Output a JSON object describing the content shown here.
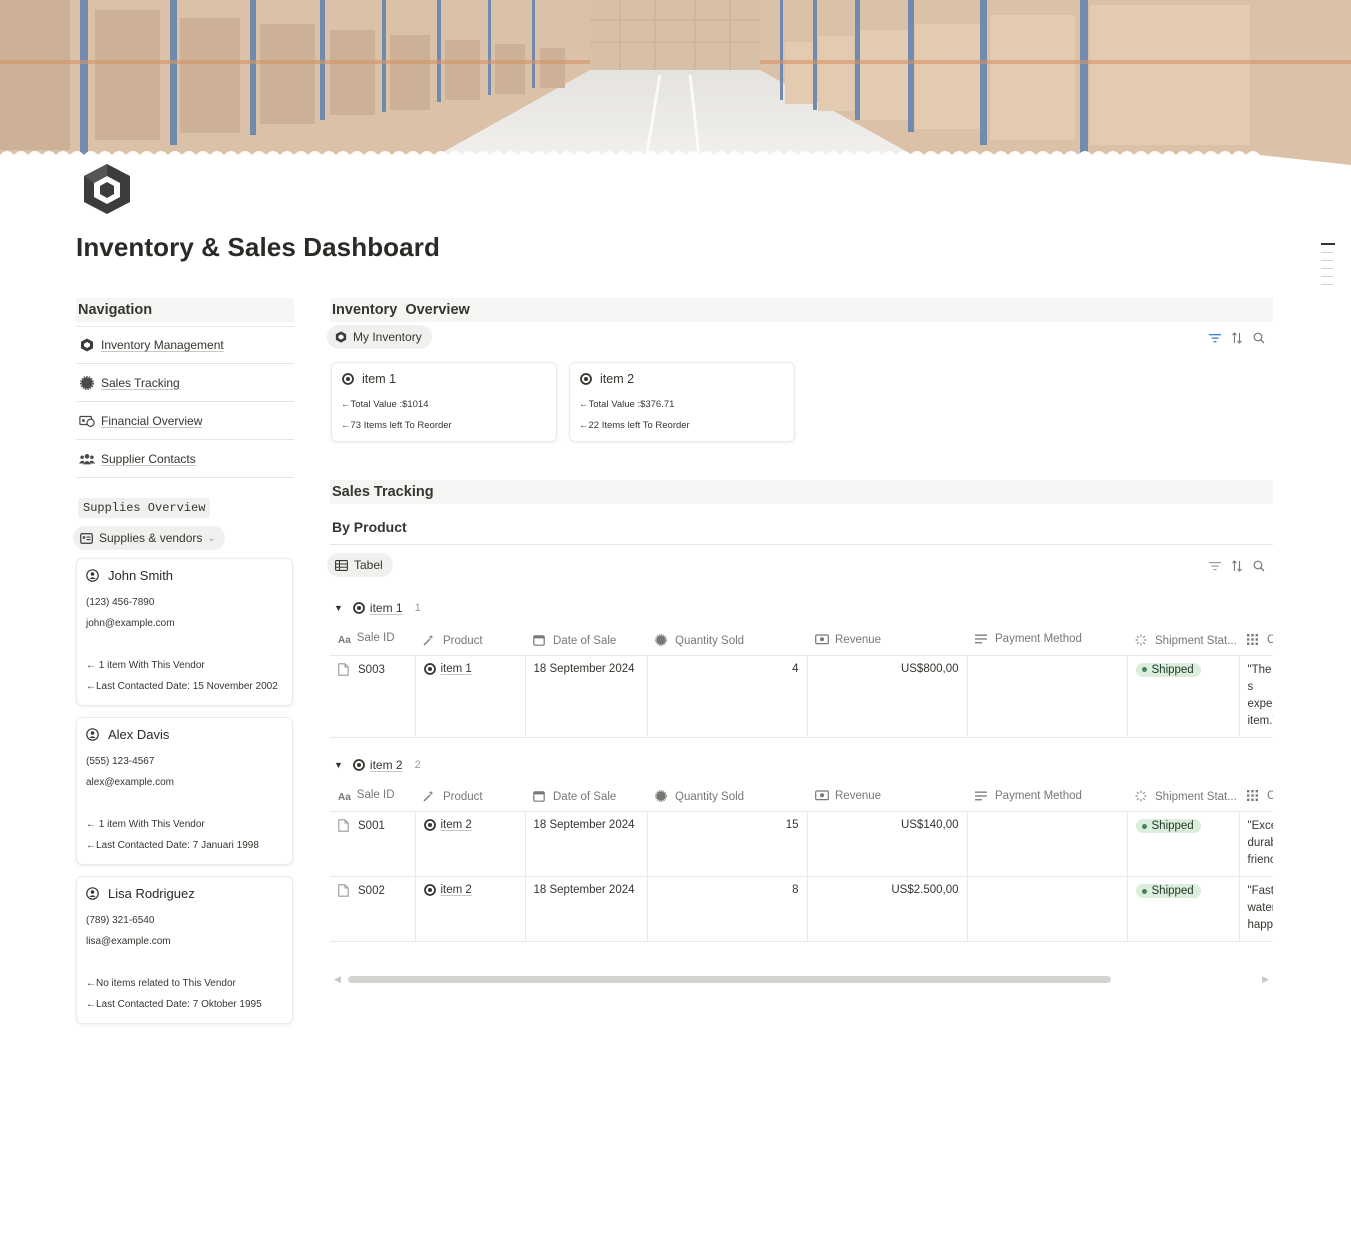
{
  "page": {
    "title": "Inventory & Sales Dashboard"
  },
  "left": {
    "navigation_header": "Navigation",
    "nav_items": [
      {
        "label": "Inventory Management",
        "icon": "box-icon"
      },
      {
        "label": "Sales Tracking",
        "icon": "badge-icon"
      },
      {
        "label": "Financial Overview",
        "icon": "money-icon"
      },
      {
        "label": "Supplier Contacts",
        "icon": "people-icon"
      }
    ],
    "supplies_label": "Supplies Overview",
    "supplies_view": "Supplies & vendors",
    "vendors": [
      {
        "name": "John Smith",
        "phone": "(123) 456-7890",
        "email": "john@example.com",
        "items": "← 1 item With This Vendor",
        "contacted": "←Last Contacted Date: 15 November 2002"
      },
      {
        "name": "Alex Davis",
        "phone": "(555) 123-4567",
        "email": "alex@example.com",
        "items": "← 1 item With This Vendor",
        "contacted": "←Last Contacted Date: 7 Januari 1998"
      },
      {
        "name": "Lisa Rodriguez",
        "phone": " (789) 321-6540",
        "email": "lisa@example.com",
        "items": "←No items related to This Vendor",
        "contacted": "←Last Contacted Date: 7 Oktober 1995"
      }
    ]
  },
  "inventory": {
    "header": "Inventory  Overview",
    "view_label": "My Inventory",
    "cards": [
      {
        "title": "item 1",
        "value": "←Total Value :$1014",
        "reorder": "←73 Items left To Reorder"
      },
      {
        "title": "item 2",
        "value": "←Total Value :$376.71",
        "reorder": "←22 Items left To Reorder"
      }
    ]
  },
  "sales": {
    "header": "Sales Tracking",
    "subheader": "By Product",
    "view_label": "Tabel",
    "columns": [
      "Sale ID",
      "Product",
      "Date of Sale",
      "Quantity Sold",
      "Revenue",
      "Payment Method",
      "Shipment Stat...",
      "C"
    ],
    "column_icons": [
      "title-aa-icon",
      "magic-wand-icon",
      "calendar-icon",
      "badge-icon",
      "money-icon",
      "text-lines-icon",
      "spinner-icon",
      "grid-icon"
    ],
    "status_color": "#dbeddb",
    "groups": [
      {
        "name": "item 1",
        "count": "1",
        "rows": [
          {
            "sale_id": "S003",
            "product": "item 1",
            "date": "18 September 2024",
            "qty": "4",
            "revenue": "US$800,00",
            "payment": "",
            "status": "Shipped",
            "comment": "\"The s expec item.\""
          }
        ]
      },
      {
        "name": "item 2",
        "count": "2",
        "rows": [
          {
            "sale_id": "S001",
            "product": "item 2",
            "date": "18 September 2024",
            "qty": "15",
            "revenue": "US$140,00",
            "payment": "",
            "status": "Shipped",
            "comment": "\"Exce durab frienc"
          },
          {
            "sale_id": "S002",
            "product": "item 2",
            "date": "18 September 2024",
            "qty": "8",
            "revenue": "US$2.500,00",
            "payment": "",
            "status": "Shipped",
            "comment": "\"Fast water happy"
          }
        ]
      }
    ]
  }
}
